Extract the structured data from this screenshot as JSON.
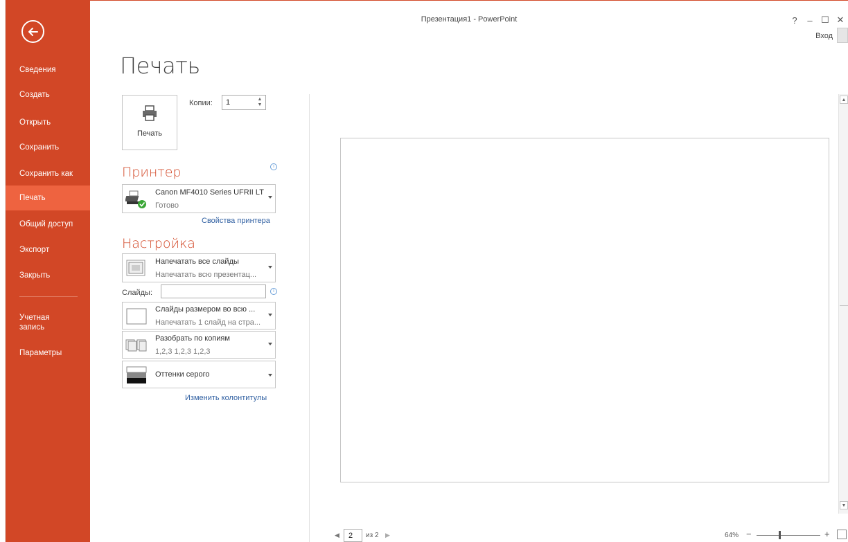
{
  "window": {
    "title": "Презентация1 - PowerPoint",
    "help": "?",
    "minimize": "–",
    "maximize": "☐",
    "close": "✕",
    "signin": "Вход"
  },
  "sidebar": {
    "items": [
      {
        "label": "Сведения"
      },
      {
        "label": "Создать"
      },
      {
        "label": "Открыть"
      },
      {
        "label": "Сохранить"
      },
      {
        "label": "Сохранить как"
      },
      {
        "label": "Печать",
        "active": true
      },
      {
        "label": "Общий доступ"
      },
      {
        "label": "Экспорт"
      },
      {
        "label": "Закрыть"
      }
    ],
    "account_line1": "Учетная",
    "account_line2": "запись",
    "options": "Параметры"
  },
  "page": {
    "title": "Печать",
    "print_button": "Печать",
    "copies_label": "Копии:",
    "copies_value": "1"
  },
  "printer": {
    "heading": "Принтер",
    "name": "Canon MF4010 Series UFRII LT",
    "status": "Готово",
    "properties_link": "Свойства принтера"
  },
  "settings": {
    "heading": "Настройка",
    "range_title": "Напечатать все слайды",
    "range_desc": "Напечатать всю презентац...",
    "slides_label": "Слайды:",
    "slides_value": "",
    "layout_title": "Слайды размером во всю ...",
    "layout_desc": "Напечатать 1 слайд на стра...",
    "collate_title": "Разобрать по копиям",
    "collate_desc": "1,2,3   1,2,3   1,2,3",
    "color_title": "Оттенки серого",
    "header_footer_link": "Изменить колонтитулы"
  },
  "preview": {
    "current_page": "2",
    "of_pages": "из 2",
    "zoom": "64%",
    "zoom_level_percent": 64
  },
  "colors": {
    "accent": "#d24726",
    "active": "#ee6340",
    "link": "#2f5fa1"
  }
}
